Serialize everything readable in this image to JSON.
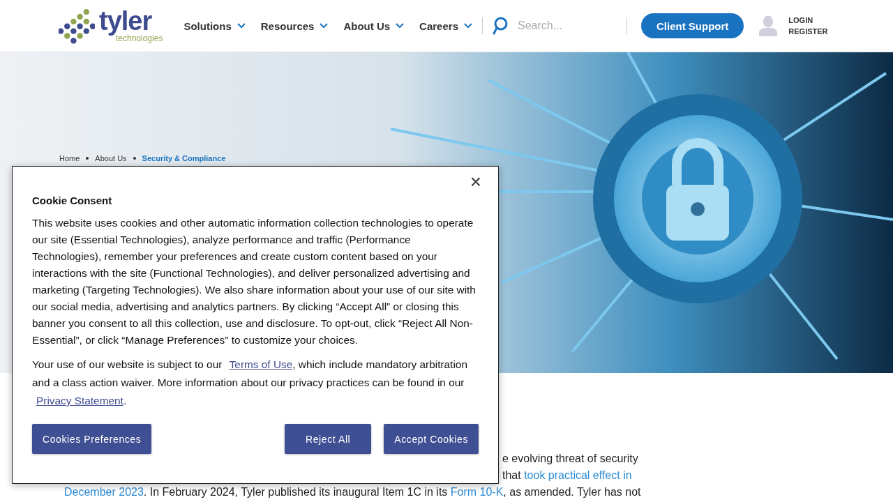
{
  "header": {
    "logo": {
      "name": "tyler",
      "tagline": "technologies"
    },
    "nav": [
      {
        "label": "Solutions"
      },
      {
        "label": "Resources"
      },
      {
        "label": "About Us"
      },
      {
        "label": "Careers"
      }
    ],
    "search": {
      "placeholder": "Search..."
    },
    "support_button": "Client Support",
    "account": [
      "LOGIN",
      "REGISTER"
    ]
  },
  "hero": {
    "kind": "picture",
    "breadcrumb": [
      {
        "label": "Home",
        "current": false
      },
      {
        "label": "About Us",
        "current": false
      },
      {
        "label": "Security & Compliance",
        "current": true
      }
    ]
  },
  "body": {
    "lines": [
      [
        {
          "text": "e evolving threat of security",
          "link": false
        }
      ],
      [
        {
          "text": "that ",
          "link": false
        },
        {
          "text": "took practical effect in",
          "link": true
        }
      ],
      [
        {
          "text": "December 2023",
          "link": true
        },
        {
          "text": ". In February 2024, Tyler published its inaugural Item 1C in its ",
          "link": false
        },
        {
          "text": "Form 10-K",
          "link": true
        },
        {
          "text": ", as amended. Tyler has not",
          "link": false
        }
      ]
    ]
  },
  "cookie_dialog": {
    "title": "Cookie Consent",
    "close": "×",
    "text": "This website uses cookies and other automatic information collection technologies to operate our site (Essential Technologies), analyze performance and traffic (Performance Technologies), remember your preferences and create custom content based on your interactions with the site (Functional Technologies), and deliver personalized advertising and marketing (Targeting Technologies). We also share information about your use of our site with our social media, advertising and analytics partners. By clicking “Accept All” or closing this banner you consent to all this collection, use and disclosure. To opt-out, click “Reject All Non-Essential”, or click “Manage Preferences” to customize your choices.",
    "terms": [
      {
        "text": "Your use of our website is subject to our ",
        "link": false
      },
      {
        "text": "Terms of Use",
        "link": true
      },
      {
        "text": ", which include mandatory arbitration and a class action waiver. More information about our privacy practices can be found in our ",
        "link": false
      },
      {
        "text": "Privacy Statement",
        "link": true
      },
      {
        "text": ".",
        "link": false
      }
    ],
    "buttons": [
      {
        "label": "Cookies Preferences"
      },
      {
        "label": "Reject All"
      },
      {
        "label": "Accept Cookies"
      }
    ]
  }
}
